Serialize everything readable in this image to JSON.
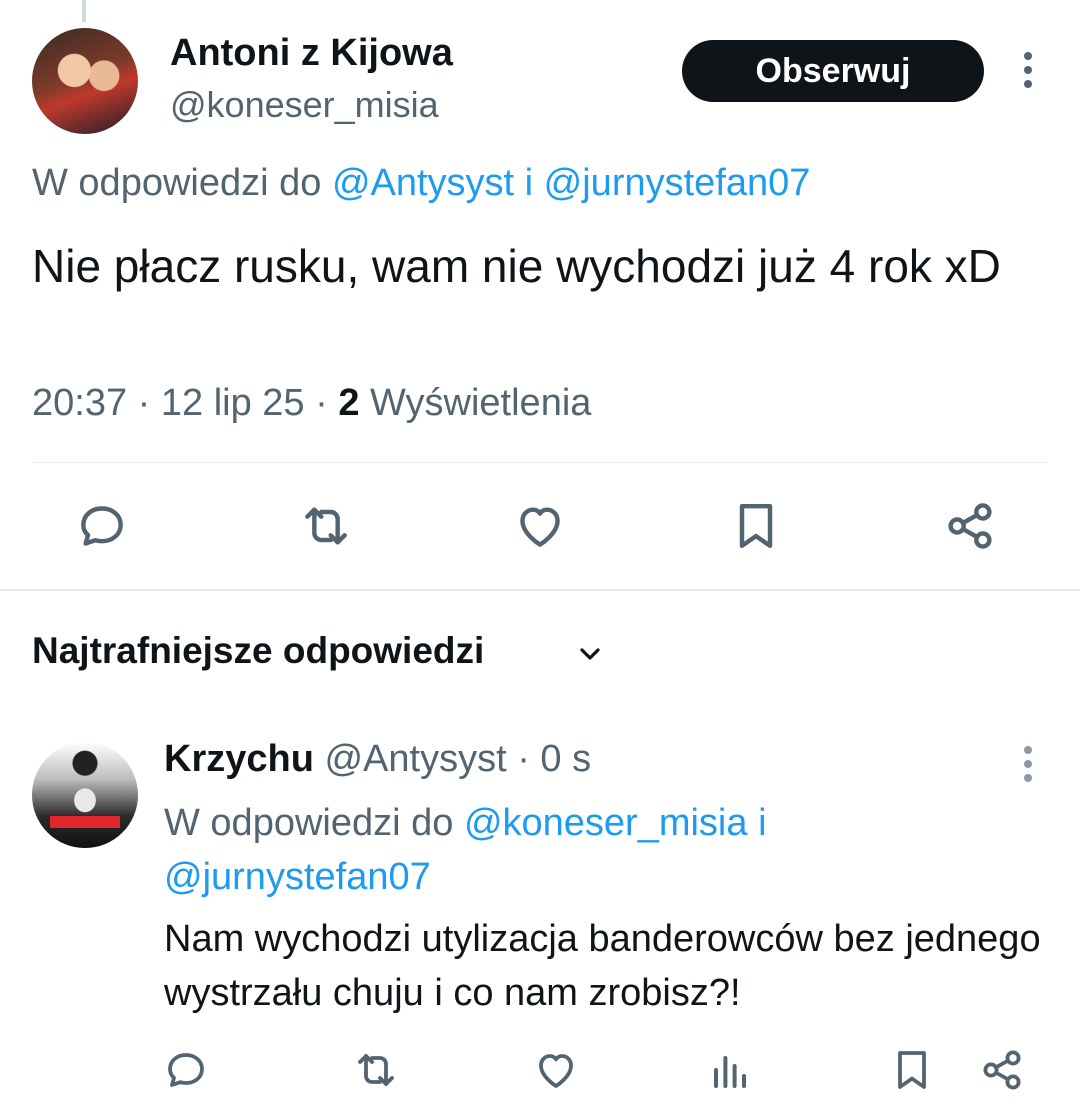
{
  "tweet": {
    "author_name": "Antoni z Kijowa",
    "author_handle": "@koneser_misia",
    "follow_label": "Obserwuj",
    "reply_prefix": "W odpowiedzi do ",
    "reply_mentions": "@Antysyst i @jurnystefan07",
    "text": "Nie płacz rusku, wam nie wychodzi już 4 rok xD",
    "time": "20:37 · 12 lip 25 · ",
    "views_count": "2",
    "views_label": " Wyświetlenia"
  },
  "replies_section": {
    "sort_label": "Najtrafniejsze odpowiedzi"
  },
  "reply": {
    "author_name": "Krzychu",
    "meta": " @Antysyst · 0 s",
    "reply_prefix": "W odpowiedzi do ",
    "reply_mentions_1": "@koneser_misia i",
    "reply_mentions_2": "@jurnystefan07",
    "text": "Nam wychodzi utylizacja banderowców bez jednego wystrzału chuju i co nam zrobisz?!"
  },
  "icons": {
    "main_actions": [
      "reply-icon",
      "repost-icon",
      "like-icon",
      "bookmark-icon",
      "share-icon"
    ],
    "reply_actions": [
      "reply-icon",
      "repost-icon",
      "like-icon",
      "views-icon",
      "bookmark-icon",
      "share-icon"
    ]
  },
  "colors": {
    "text": "#0f1419",
    "secondary": "#536471",
    "accent": "#1d9bf0",
    "button_bg": "#0f1419"
  }
}
